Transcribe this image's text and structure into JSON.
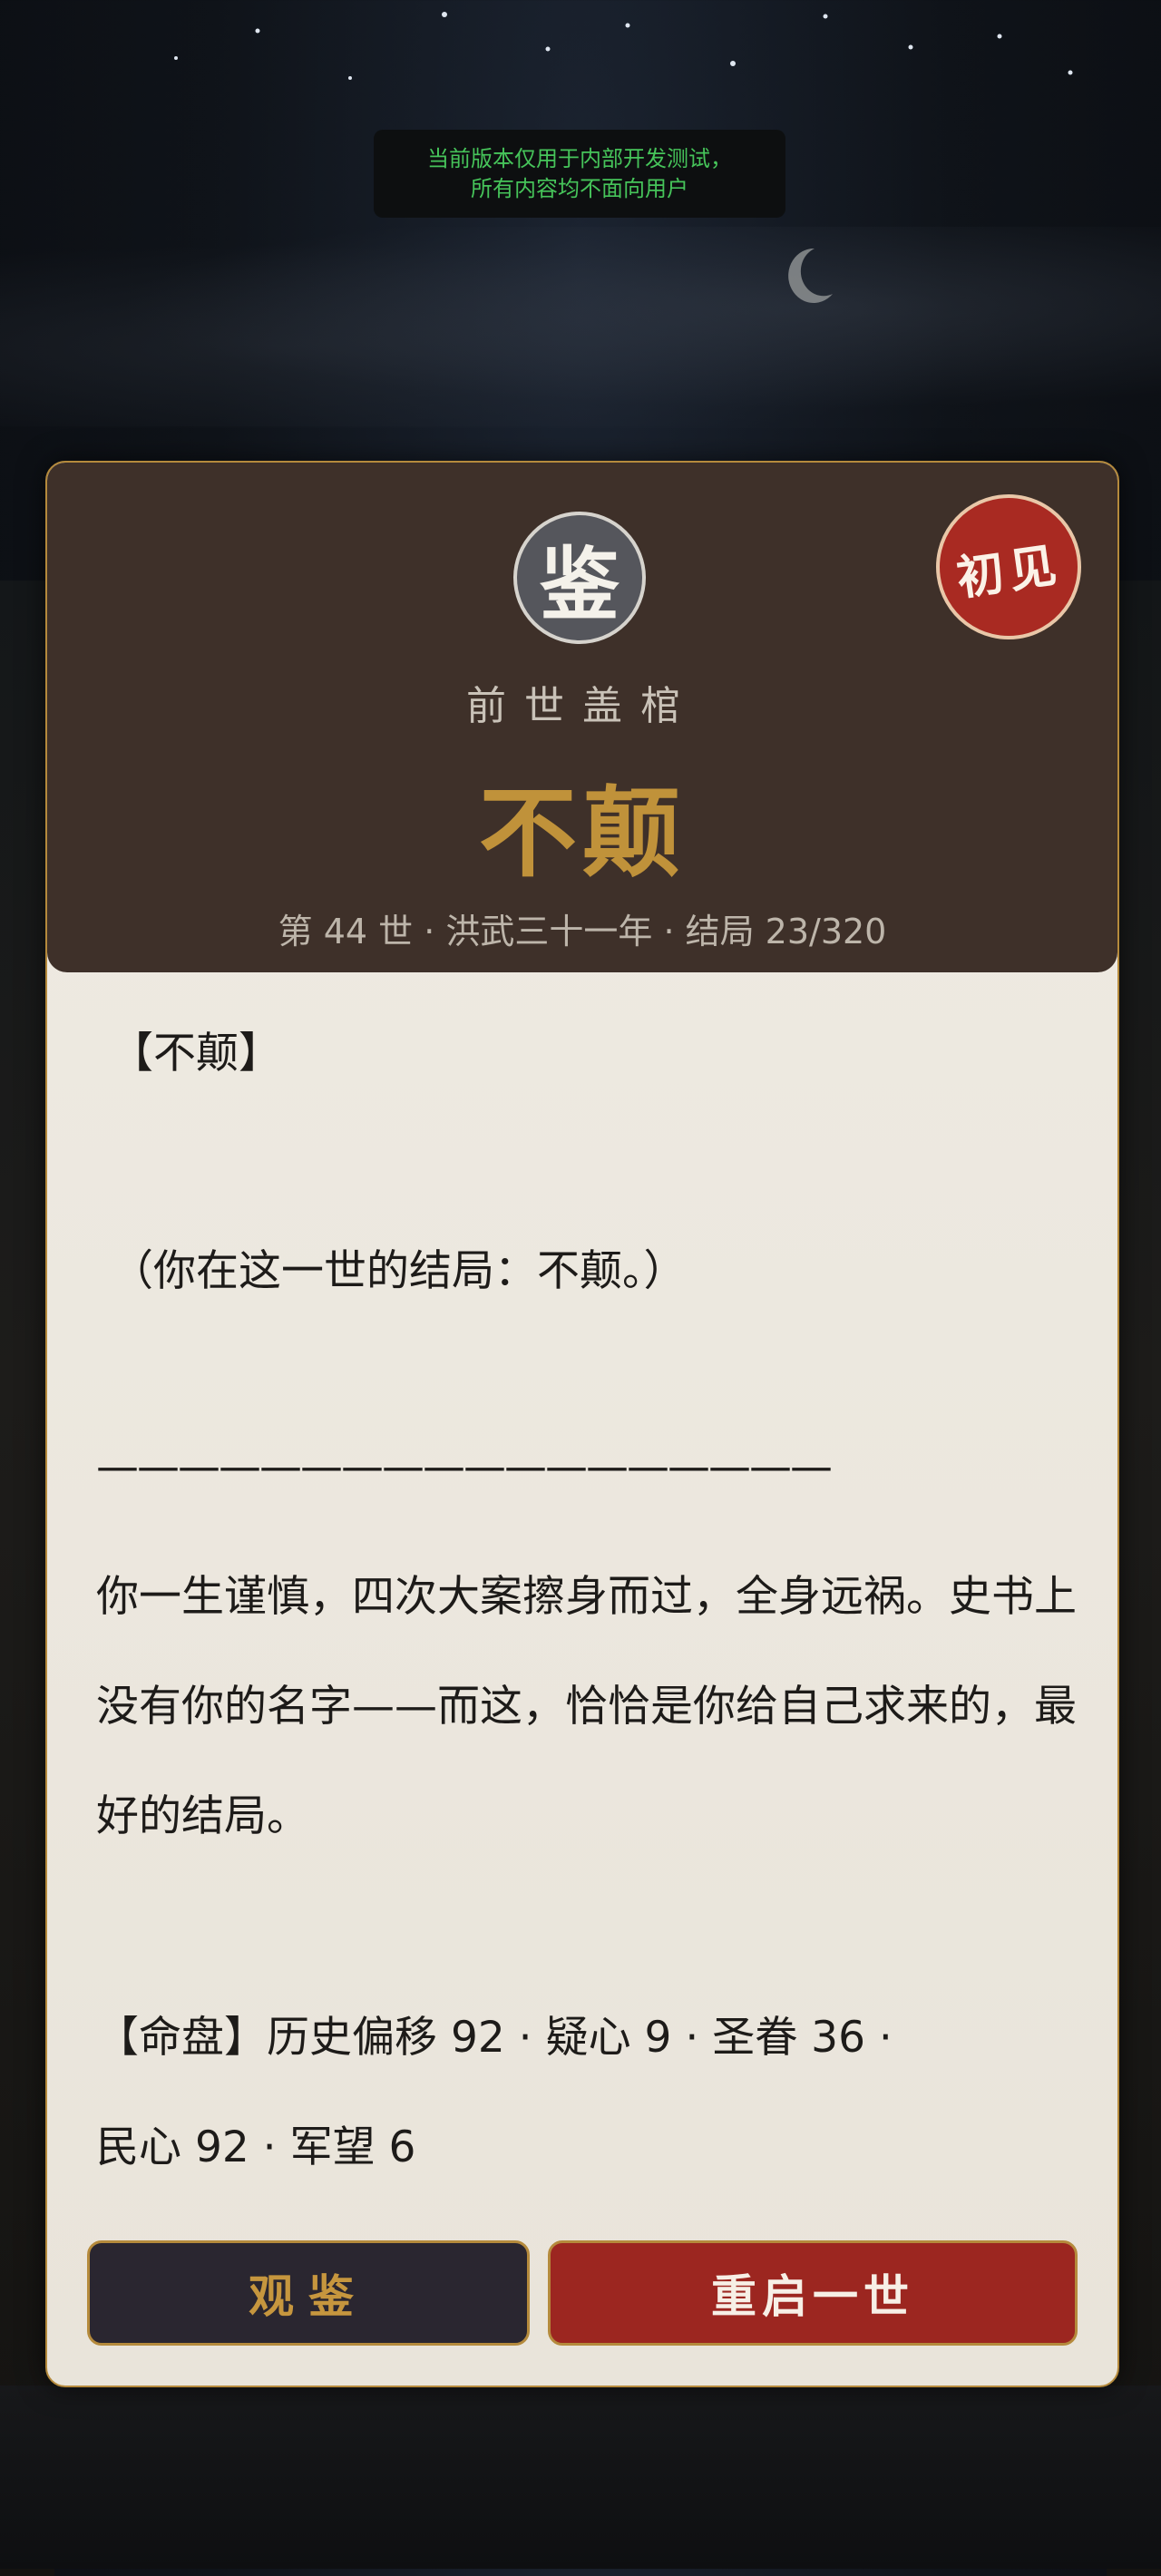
{
  "banner": {
    "line1": "当前版本仅用于内部开发测试，",
    "line2": "所有内容均不面向用户"
  },
  "card": {
    "seal_char": "鉴",
    "badge": "初见",
    "subtitle": "前世盖棺",
    "ending_title": "不颠",
    "meta": "第 44 世 · 洪武三十一年 · 结局 23/320",
    "lines": {
      "bracket_title": "【不颠】",
      "ending_note": "（你在这一世的结局：不颠。）",
      "divider": "——————————————————",
      "paragraph": "你一生谨慎，四次大案擦身而过，全身远祸。史书上没有你的名字——而这，恰恰是你给自己求来的，最好的结局。",
      "stats_line1": "【命盘】历史偏移 92 · 疑心 9 · 圣眷 36 ·",
      "stats_line2": "民心 92 · 军望 6"
    },
    "buttons": {
      "review": "观鉴",
      "restart": "重启一世"
    }
  },
  "colors": {
    "accent_gold": "#c0923a",
    "header_bg": "#3e3029",
    "restart_red": "#9c2620",
    "dev_green": "#46c45a"
  }
}
